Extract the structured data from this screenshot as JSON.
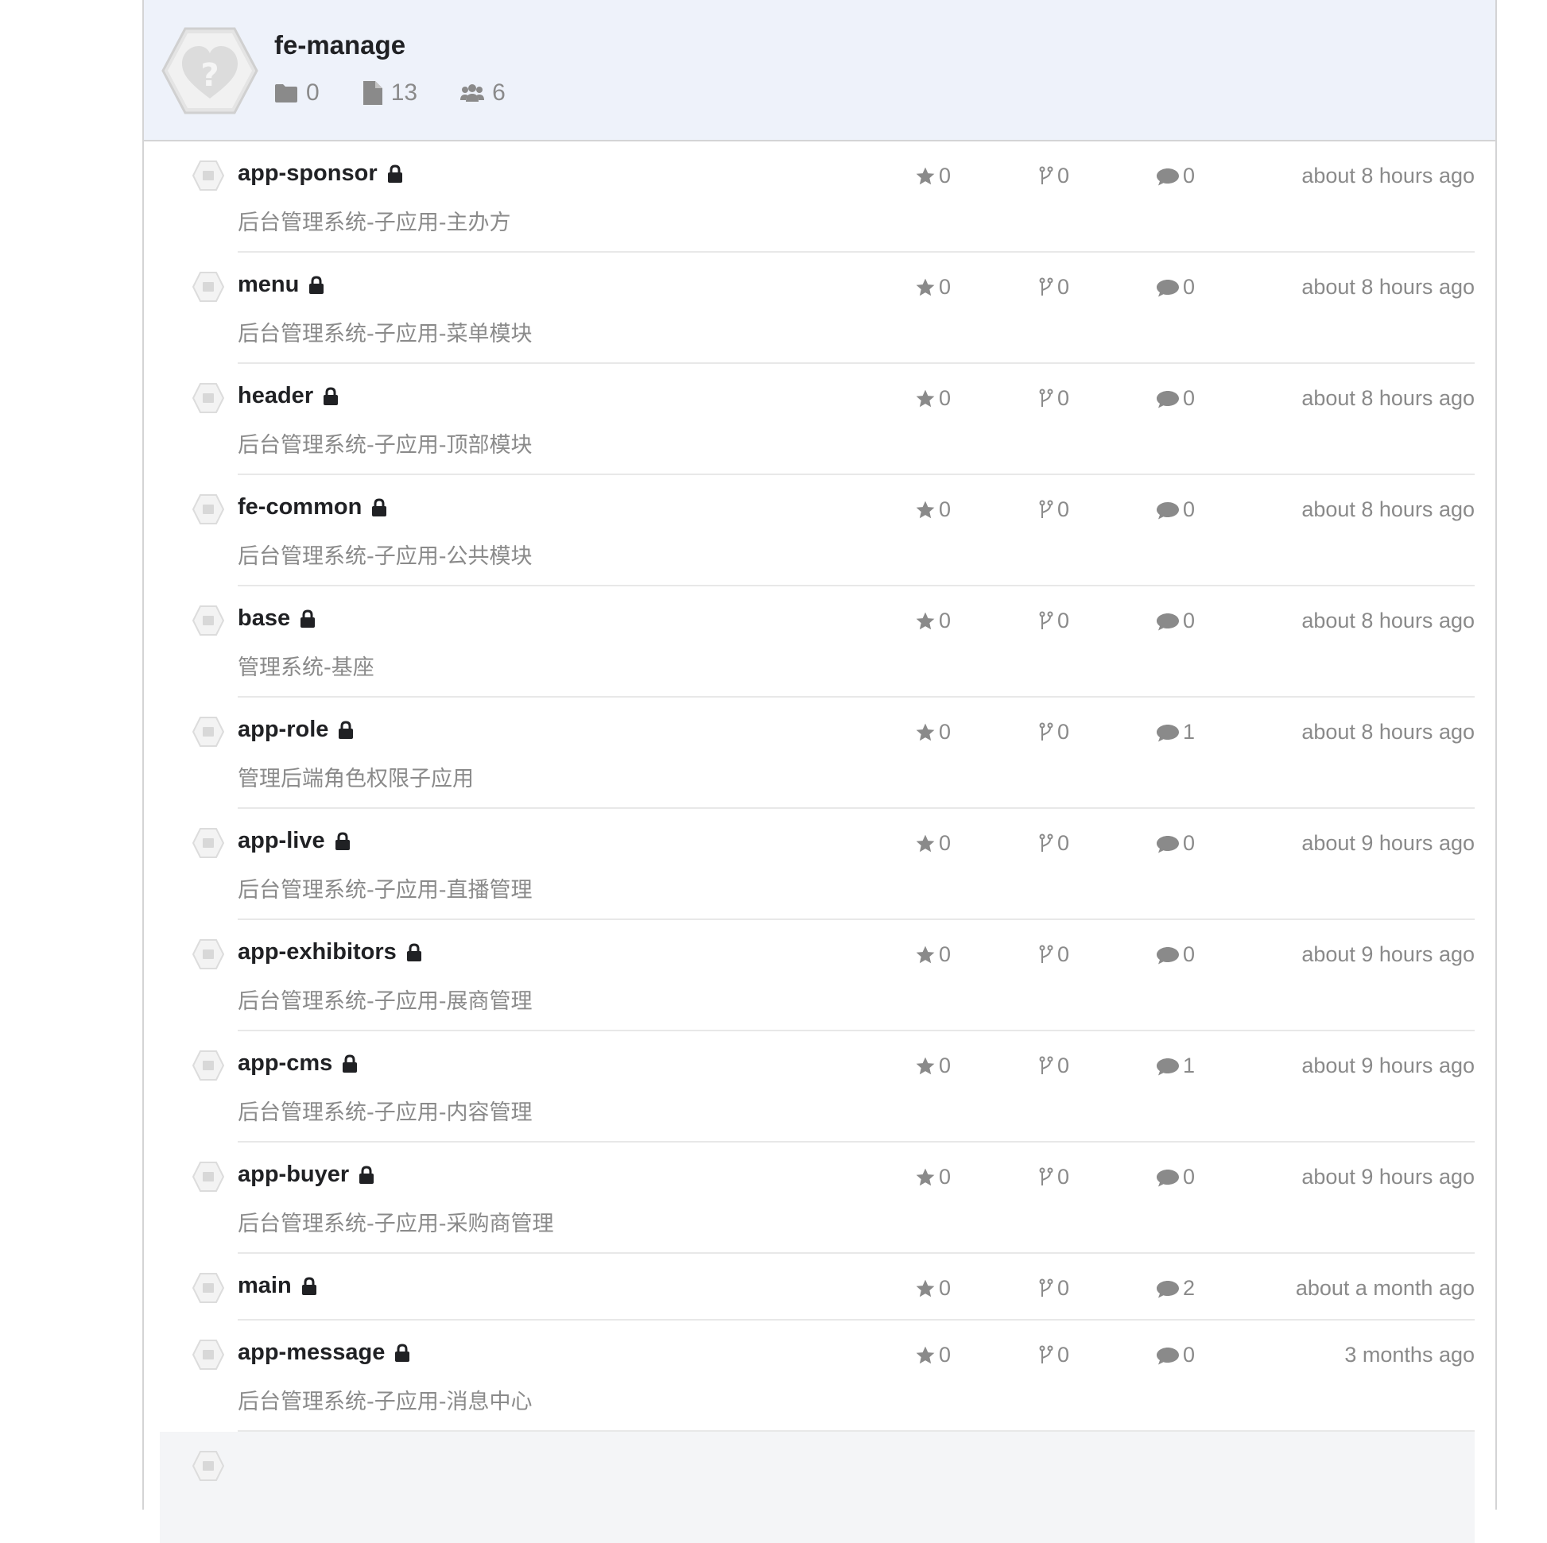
{
  "org": {
    "name": "fe-manage",
    "folders": "0",
    "files": "13",
    "members": "6"
  },
  "repos": [
    {
      "name": "app-sponsor",
      "desc": "后台管理系统-子应用-主办方",
      "stars": "0",
      "forks": "0",
      "comments": "0",
      "time": "about 8 hours ago"
    },
    {
      "name": "menu",
      "desc": "后台管理系统-子应用-菜单模块",
      "stars": "0",
      "forks": "0",
      "comments": "0",
      "time": "about 8 hours ago"
    },
    {
      "name": "header",
      "desc": "后台管理系统-子应用-顶部模块",
      "stars": "0",
      "forks": "0",
      "comments": "0",
      "time": "about 8 hours ago"
    },
    {
      "name": "fe-common",
      "desc": "后台管理系统-子应用-公共模块",
      "stars": "0",
      "forks": "0",
      "comments": "0",
      "time": "about 8 hours ago"
    },
    {
      "name": "base",
      "desc": "管理系统-基座",
      "stars": "0",
      "forks": "0",
      "comments": "0",
      "time": "about 8 hours ago"
    },
    {
      "name": "app-role",
      "desc": "管理后端角色权限子应用",
      "stars": "0",
      "forks": "0",
      "comments": "1",
      "time": "about 8 hours ago"
    },
    {
      "name": "app-live",
      "desc": "后台管理系统-子应用-直播管理",
      "stars": "0",
      "forks": "0",
      "comments": "0",
      "time": "about 9 hours ago"
    },
    {
      "name": "app-exhibitors",
      "desc": "后台管理系统-子应用-展商管理",
      "stars": "0",
      "forks": "0",
      "comments": "0",
      "time": "about 9 hours ago"
    },
    {
      "name": "app-cms",
      "desc": "后台管理系统-子应用-内容管理",
      "stars": "0",
      "forks": "0",
      "comments": "1",
      "time": "about 9 hours ago"
    },
    {
      "name": "app-buyer",
      "desc": "后台管理系统-子应用-采购商管理",
      "stars": "0",
      "forks": "0",
      "comments": "0",
      "time": "about 9 hours ago"
    },
    {
      "name": "main",
      "desc": "",
      "stars": "0",
      "forks": "0",
      "comments": "2",
      "time": "about a month ago"
    },
    {
      "name": "app-message",
      "desc": "后台管理系统-子应用-消息中心",
      "stars": "0",
      "forks": "0",
      "comments": "0",
      "time": "3 months ago"
    }
  ],
  "icons": {
    "folder": "folder-icon",
    "file": "file-icon",
    "members": "users-icon",
    "lock": "lock-icon",
    "star": "star-icon",
    "fork": "fork-icon",
    "comment": "comment-icon",
    "repo": "repo-icon"
  },
  "colors": {
    "header_bg": "#eef2fa",
    "title": "#202124",
    "muted": "#8a8a8a"
  }
}
